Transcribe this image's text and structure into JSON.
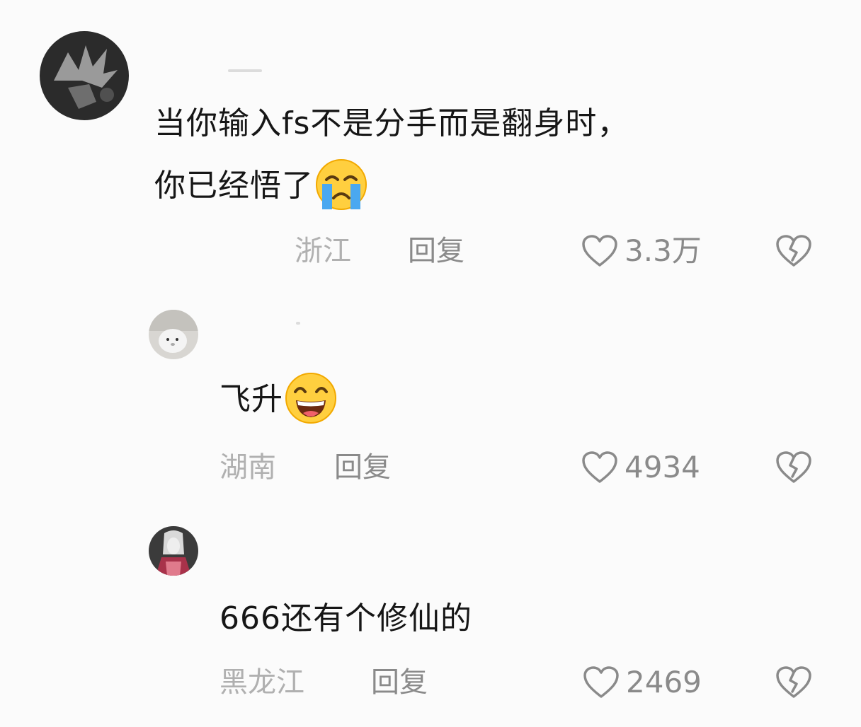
{
  "comments": [
    {
      "text_line1": "当你输入fs不是分手而是翻身时，",
      "text_line2": "你已经悟了",
      "emoji": "loudly-crying-face",
      "location": "浙江",
      "reply_label": "回复",
      "likes": "3.3万"
    },
    {
      "text": "飞升",
      "emoji": "grinning-squinting-face",
      "location": "湖南",
      "reply_label": "回复",
      "likes": "4934"
    },
    {
      "text": "666还有个修仙的",
      "location": "黑龙江",
      "reply_label": "回复",
      "likes": "2469"
    }
  ],
  "icons": {
    "like": "heart-outline-icon",
    "dislike": "broken-heart-icon"
  },
  "colors": {
    "background": "#fbfbfb",
    "text": "#161616",
    "location": "#b0b0b0",
    "secondary": "#8a8a8a"
  }
}
